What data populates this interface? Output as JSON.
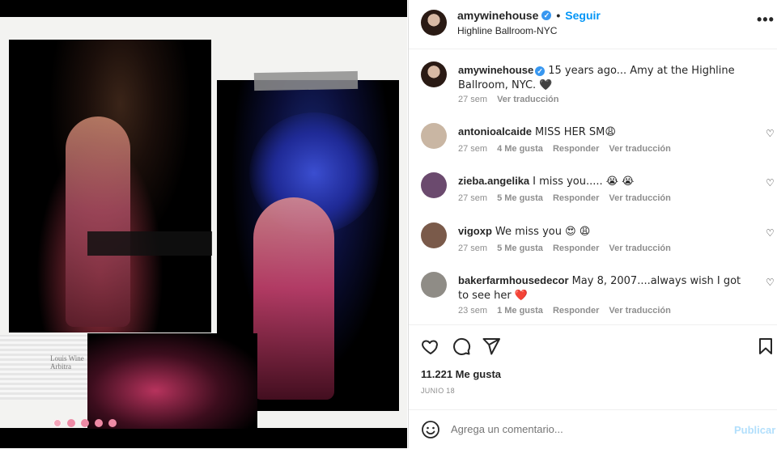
{
  "header": {
    "username": "amywinehouse",
    "separator": "•",
    "follow_label": "Seguir",
    "location": "Highline Ballroom-NYC",
    "more_glyph": "•••"
  },
  "media": {
    "newspaper_text": "Louis Wine Arbitra",
    "carousel_dots": 5
  },
  "caption": {
    "username": "amywinehouse",
    "text": "15 years ago... Amy at the Highline Ballroom, NYC. 🖤",
    "time": "27 sem",
    "translate": "Ver traducción"
  },
  "comments": [
    {
      "username": "antonioalcaide",
      "text": "MISS HER SM😩",
      "time": "27 sem",
      "likes": "4 Me gusta",
      "reply": "Responder",
      "translate": "Ver traducción",
      "avatar_color": "#c9b6a3"
    },
    {
      "username": "zieba.angelika",
      "text": "I miss you..... 😭 😭",
      "time": "27 sem",
      "likes": "5 Me gusta",
      "reply": "Responder",
      "translate": "Ver traducción",
      "avatar_color": "#6b4a6e"
    },
    {
      "username": "vigoxp",
      "text": "We miss you 😍 😩",
      "time": "27 sem",
      "likes": "5 Me gusta",
      "reply": "Responder",
      "translate": "Ver traducción",
      "avatar_color": "#7a5a4a"
    },
    {
      "username": "bakerfarmhousedecor",
      "text": "May 8, 2007....always wish I got to see her ❤️",
      "time": "23 sem",
      "likes": "1 Me gusta",
      "reply": "Responder",
      "translate": "Ver traducción",
      "avatar_color": "#8f8c86"
    }
  ],
  "likes": "11.221 Me gusta",
  "date": "JUNIO 18",
  "add_comment": {
    "placeholder": "Agrega un comentario...",
    "post_label": "Publicar"
  },
  "colors": {
    "link": "#0095f6",
    "verified": "#3897f0",
    "muted": "#8e8e8e",
    "post_disabled": "#b2dffc",
    "dots": "#ee8aa5"
  }
}
